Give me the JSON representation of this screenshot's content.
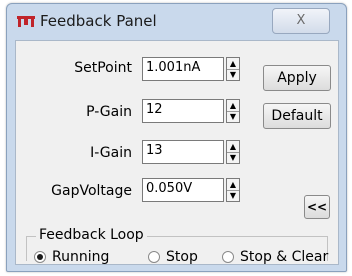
{
  "window": {
    "title": "Feedback Panel",
    "close_label": "X"
  },
  "fields": [
    {
      "label": "SetPoint",
      "value": "1.001nA"
    },
    {
      "label": "P-Gain",
      "value": "12"
    },
    {
      "label": "I-Gain",
      "value": "13"
    },
    {
      "label": "GapVoltage",
      "value": "0.050V"
    }
  ],
  "buttons": {
    "apply": "Apply",
    "default": "Default",
    "collapse": "<<"
  },
  "feedback_loop": {
    "legend": "Feedback Loop",
    "options": [
      "Running",
      "Stop",
      "Stop & Clear"
    ],
    "selected": "Running"
  },
  "spinner": {
    "up": "▲",
    "down": "▼"
  }
}
